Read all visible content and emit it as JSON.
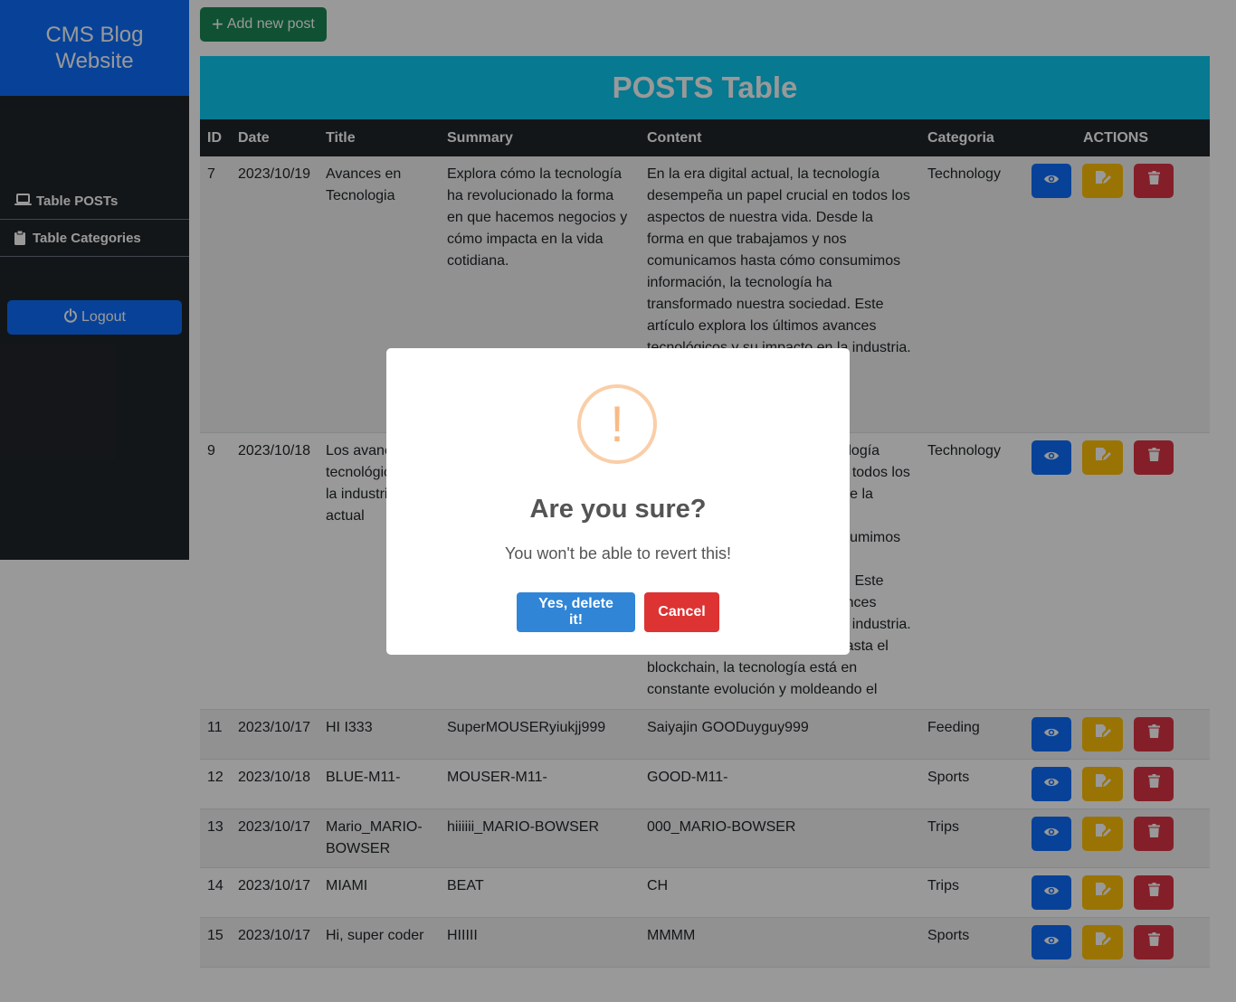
{
  "sidebar": {
    "brand": "CMS Blog Website",
    "items": [
      {
        "label": "Table POSTs",
        "icon": "laptop-icon"
      },
      {
        "label": "Table Categories",
        "icon": "clipboard-icon"
      }
    ],
    "logout_label": "Logout"
  },
  "toolbar": {
    "add_label": "Add new post"
  },
  "posts": {
    "title": "POSTS Table",
    "columns": [
      "ID",
      "Date",
      "Title",
      "Summary",
      "Content",
      "Categoria",
      "ACTIONS"
    ],
    "rows": [
      {
        "id": "7",
        "date": "2023/10/19",
        "title": "Avances en Tecnologia",
        "summary": "Explora cómo la tecnología ha revolucionado la forma en que hacemos negocios y cómo impacta en la vida cotidiana.",
        "content": "En la era digital actual, la tecnología desempeña un papel crucial en todos los aspectos de nuestra vida. Desde la forma en que trabajamos y nos comunicamos hasta cómo consumimos información, la tecnología ha transformado nuestra sociedad. Este artículo explora los últimos avances tecnológicos y su impacto en la industria. Desde la inteligencia artificial",
        "category": "Technology"
      },
      {
        "id": "9",
        "date": "2023/10/18",
        "title": "Los avances tecnológicos en la industria actual",
        "summary": "",
        "content": "En la era digital actual, la tecnología desempeña un papel crucial en todos los aspectos de nuestra vida. Desde la forma en que trabajamos y nos comunicamos hasta cómo consumimos información, la tecnología ha transformado nuestra sociedad. Este artículo explora los últimos avances tecnológicos y su impacto en la industria. Desde la inteligencia artificial hasta el blockchain, la tecnología está en constante evolución y moldeando el futuro.",
        "category": "Technology"
      },
      {
        "id": "11",
        "date": "2023/10/17",
        "title": "HI I333",
        "summary": "SuperMOUSERyiukjj999",
        "content": "Saiyajin GOODuyguy999",
        "category": "Feeding"
      },
      {
        "id": "12",
        "date": "2023/10/18",
        "title": "BLUE-M11-",
        "summary": "MOUSER-M11-",
        "content": "GOOD-M11-",
        "category": "Sports"
      },
      {
        "id": "13",
        "date": "2023/10/17",
        "title": "Mario_MARIO-BOWSER",
        "summary": "hiiiiii_MARIO-BOWSER",
        "content": "000_MARIO-BOWSER",
        "category": "Trips"
      },
      {
        "id": "14",
        "date": "2023/10/17",
        "title": "MIAMI",
        "summary": "BEAT",
        "content": "CH",
        "category": "Trips"
      },
      {
        "id": "15",
        "date": "2023/10/17",
        "title": "Hi, super coder",
        "summary": "HIIIII",
        "content": "MMMM",
        "category": "Sports"
      }
    ]
  },
  "dialog": {
    "icon": "!",
    "title": "Are you sure?",
    "text": "You won't be able to revert this!",
    "confirm_label": "Yes, delete it!",
    "cancel_label": "Cancel"
  },
  "colors": {
    "primary": "#0d6efd",
    "success": "#198754",
    "warning": "#ffc107",
    "danger": "#dc3545",
    "info": "#0dcaf0",
    "dark": "#212529",
    "dialog_confirm": "#3085d6",
    "dialog_cancel": "#dd3333"
  }
}
